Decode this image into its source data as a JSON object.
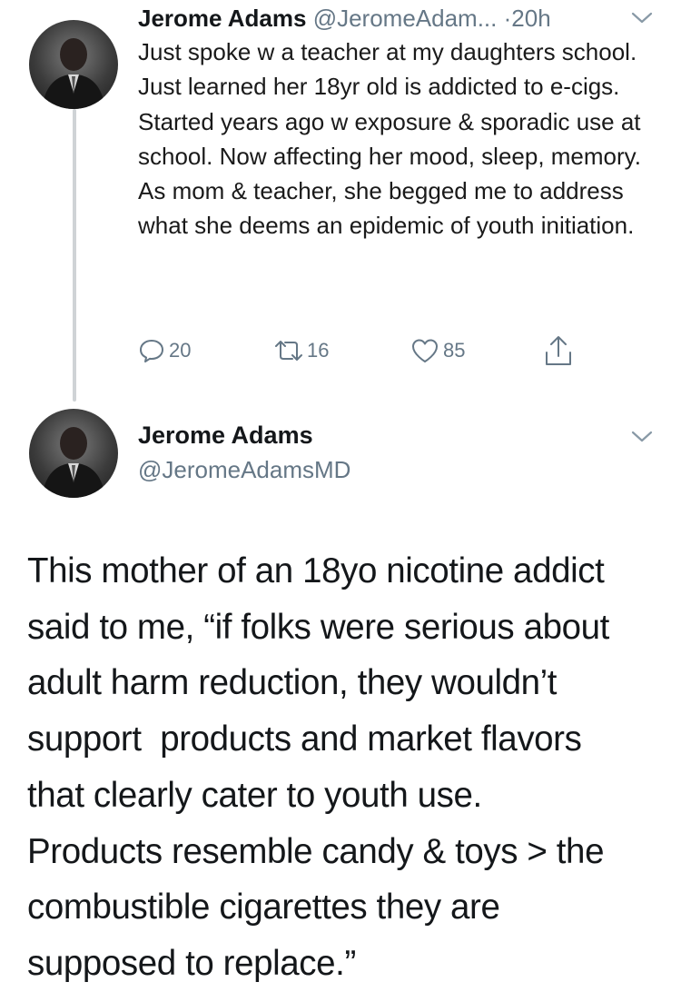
{
  "tweet1": {
    "name": "Jerome Adams",
    "handle": "@JeromeAdam...",
    "separator": "·",
    "time": "20h",
    "text": "Just spoke w a teacher at my daughters school. Just learned her 18yr old is addicted to e-cigs. Started years ago w exposure & sporadic use at school. Now affecting her mood, sleep, memory. As mom & teacher, she begged me to address what she deems an epidemic of youth initiation.",
    "replies": "20",
    "retweets": "16",
    "likes": "85",
    "icons": [
      "chevron-down-icon",
      "reply-icon",
      "retweet-icon",
      "like-icon",
      "share-icon"
    ]
  },
  "tweet2": {
    "name": "Jerome Adams",
    "handle": "@JeromeAdamsMD",
    "lines": [
      "This mother of an 18yo nicotine addict",
      "said to me, “if folks were serious about",
      "adult harm reduction, they wouldn’t",
      "support  products and market flavors",
      "that clearly cater to youth use.",
      "Products resemble candy & toys > the",
      "combustible cigarettes they are",
      "supposed to replace.”"
    ]
  },
  "colors": {
    "text": "#14171a",
    "secondary": "#657786",
    "thread_line": "#cfd3d6"
  }
}
